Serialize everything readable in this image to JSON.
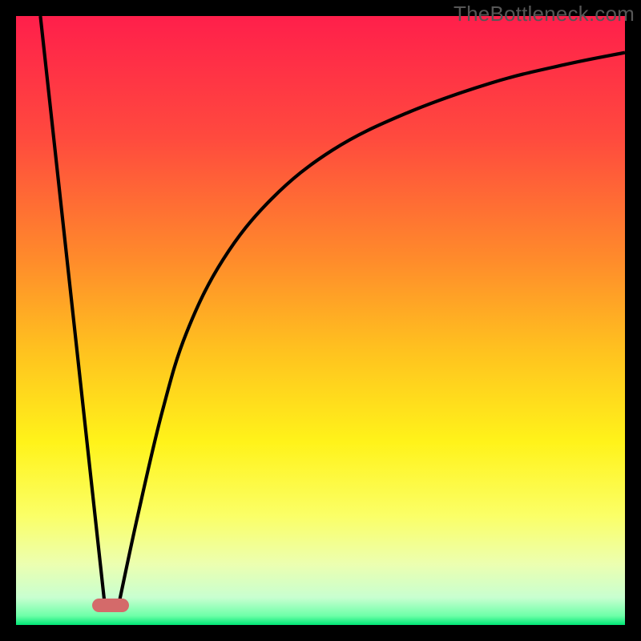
{
  "watermark": "TheBottleneck.com",
  "chart_data": {
    "type": "line",
    "title": "",
    "xlabel": "",
    "ylabel": "",
    "xlim": [
      0,
      100
    ],
    "ylim": [
      0,
      100
    ],
    "grid": false,
    "legend": false,
    "gradient_stops": [
      {
        "pos": 0,
        "color": "#ff1f4b"
      },
      {
        "pos": 0.2,
        "color": "#ff4a3e"
      },
      {
        "pos": 0.4,
        "color": "#ff8b2b"
      },
      {
        "pos": 0.55,
        "color": "#ffc21f"
      },
      {
        "pos": 0.7,
        "color": "#fff31a"
      },
      {
        "pos": 0.82,
        "color": "#fbff66"
      },
      {
        "pos": 0.9,
        "color": "#ecffb0"
      },
      {
        "pos": 0.955,
        "color": "#c8ffd0"
      },
      {
        "pos": 0.985,
        "color": "#6effa8"
      },
      {
        "pos": 1.0,
        "color": "#00e676"
      }
    ],
    "series": [
      {
        "name": "left-line",
        "x": [
          4,
          14.5
        ],
        "y": [
          100,
          4
        ]
      },
      {
        "name": "right-curve",
        "x": [
          17,
          20,
          24,
          28,
          34,
          42,
          52,
          64,
          78,
          90,
          100
        ],
        "y": [
          4,
          18,
          35,
          48,
          60,
          70,
          78,
          84,
          89,
          92,
          94
        ]
      }
    ],
    "dip_marker": {
      "x": 15.5,
      "y": 3.2,
      "w": 6,
      "h": 2.2
    }
  }
}
